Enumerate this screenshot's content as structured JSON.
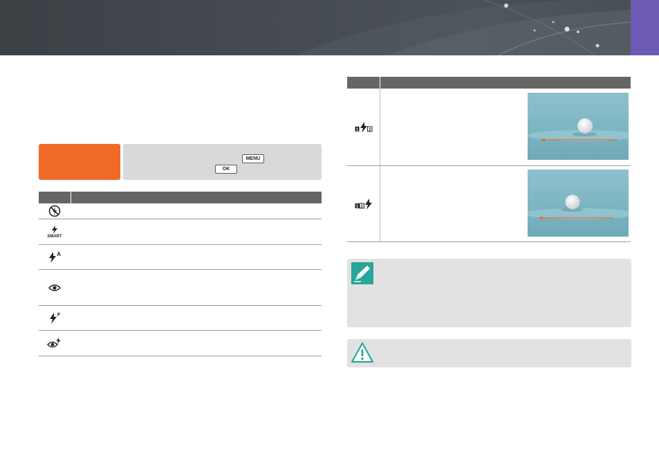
{
  "colors": {
    "banner": "#444a50",
    "section_tab": "#6d5bb3",
    "mode_highlight": "#ef6a27",
    "instruction_box": "#d9d9d9",
    "table_header": "#666666",
    "note_box": "#e2e2e2",
    "note_icon": "#2aa59a",
    "photo_arrow": "#ef6a27"
  },
  "instructions": {
    "menu_key": "MENU",
    "ok_key": "OK"
  },
  "flash_table": {
    "rows": [
      {
        "icon": "flash-off-icon"
      },
      {
        "icon": "smart-flash-icon",
        "label": "SMART"
      },
      {
        "icon": "auto-flash-icon",
        "label": "A"
      },
      {
        "icon": "red-eye-icon"
      },
      {
        "icon": "fill-in-flash-icon",
        "label": "F"
      },
      {
        "icon": "red-eye-fix-icon"
      }
    ]
  },
  "curtain_table": {
    "rows": [
      {
        "icon": "first-curtain-icon"
      },
      {
        "icon": "second-curtain-icon"
      }
    ]
  },
  "notes": [
    {
      "icon": "pencil-note-icon"
    },
    {
      "icon": "warning-icon"
    }
  ]
}
